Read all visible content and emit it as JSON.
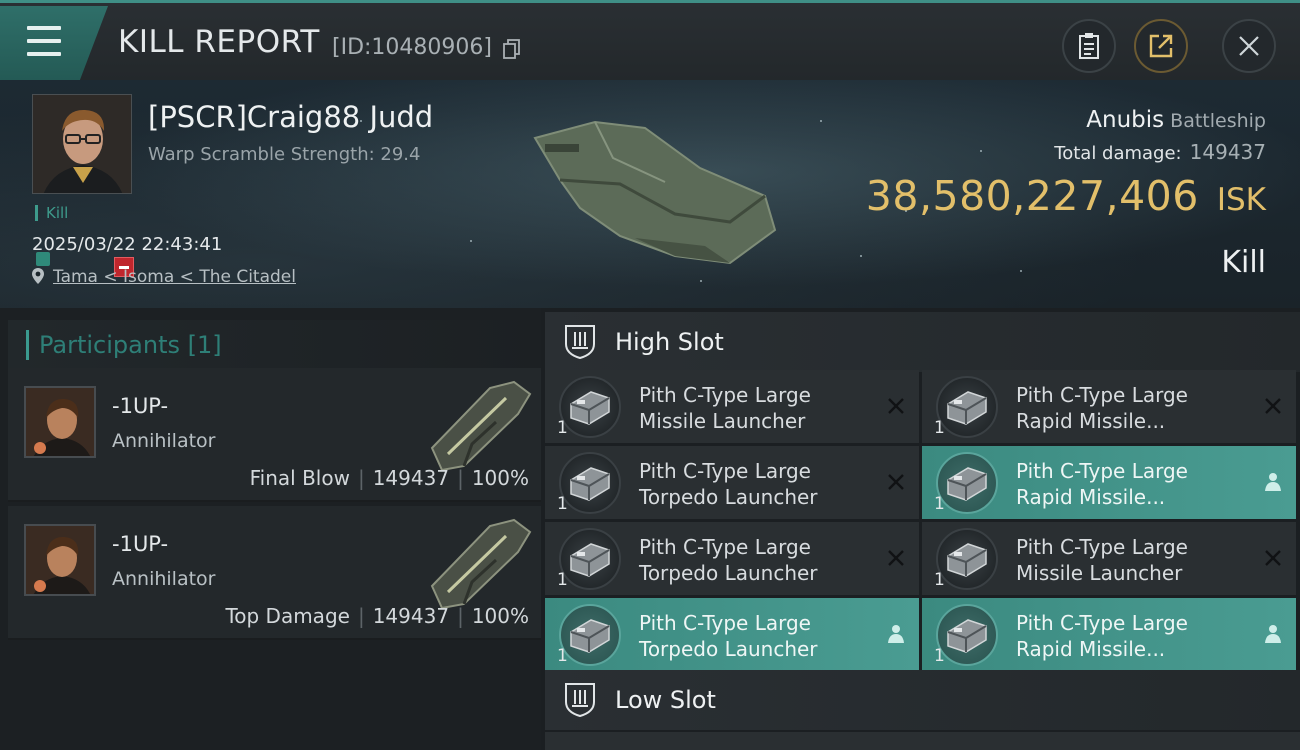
{
  "header": {
    "title": "KILL REPORT",
    "kill_id": "[ID:10480906]"
  },
  "victim": {
    "name": "[PSCR]Craig88 Judd",
    "warp_scramble": "Warp Scramble Strength: 29.4",
    "kill_tag": "Kill",
    "timestamp": "2025/03/22 22:43:41",
    "location": "Tama < Isoma < The Citadel",
    "ship_name": "Anubis",
    "ship_class": "Battleship",
    "total_damage_label": "Total damage:",
    "total_damage": "149437",
    "isk_value": "38,580,227,406",
    "isk_unit": "ISK",
    "result": "Kill"
  },
  "participants": {
    "title": "Participants [1]",
    "rows": [
      {
        "name": "-1UP-",
        "ship": "Annihilator",
        "role": "Final Blow",
        "damage": "149437",
        "percent": "100%"
      },
      {
        "name": "-1UP-",
        "ship": "Annihilator",
        "role": "Top Damage",
        "damage": "149437",
        "percent": "100%"
      }
    ]
  },
  "high_slot": {
    "title": "High Slot",
    "modules": [
      {
        "line1": "Pith C-Type Large",
        "line2": "Missile Launcher",
        "qty": "1",
        "status": "dropped"
      },
      {
        "line1": "Pith C-Type Large",
        "line2": "Rapid Missile...",
        "qty": "1",
        "status": "dropped"
      },
      {
        "line1": "Pith C-Type Large",
        "line2": "Torpedo Launcher",
        "qty": "1",
        "status": "dropped"
      },
      {
        "line1": "Pith C-Type Large",
        "line2": "Rapid Missile...",
        "qty": "1",
        "status": "fitted"
      },
      {
        "line1": "Pith C-Type Large",
        "line2": "Torpedo Launcher",
        "qty": "1",
        "status": "dropped"
      },
      {
        "line1": "Pith C-Type Large",
        "line2": "Missile Launcher",
        "qty": "1",
        "status": "dropped"
      },
      {
        "line1": "Pith C-Type Large",
        "line2": "Torpedo Launcher",
        "qty": "1",
        "status": "fitted"
      },
      {
        "line1": "Pith C-Type Large",
        "line2": "Rapid Missile...",
        "qty": "1",
        "status": "fitted"
      }
    ]
  },
  "low_slot": {
    "title": "Low Slot"
  },
  "icons": {
    "menu": "hamburger-icon",
    "copy": "copy-icon",
    "clipboard": "clipboard-icon",
    "share": "share-icon",
    "close": "close-icon",
    "location": "pin-icon",
    "slot": "shield-slot-icon",
    "dropped": "x-icon",
    "fitted": "person-icon"
  },
  "colors": {
    "accent": "#3e9b8c",
    "isk": "#e2bf6a",
    "hostile": "#c0262d",
    "fitted_bg": "#4a9c92"
  }
}
